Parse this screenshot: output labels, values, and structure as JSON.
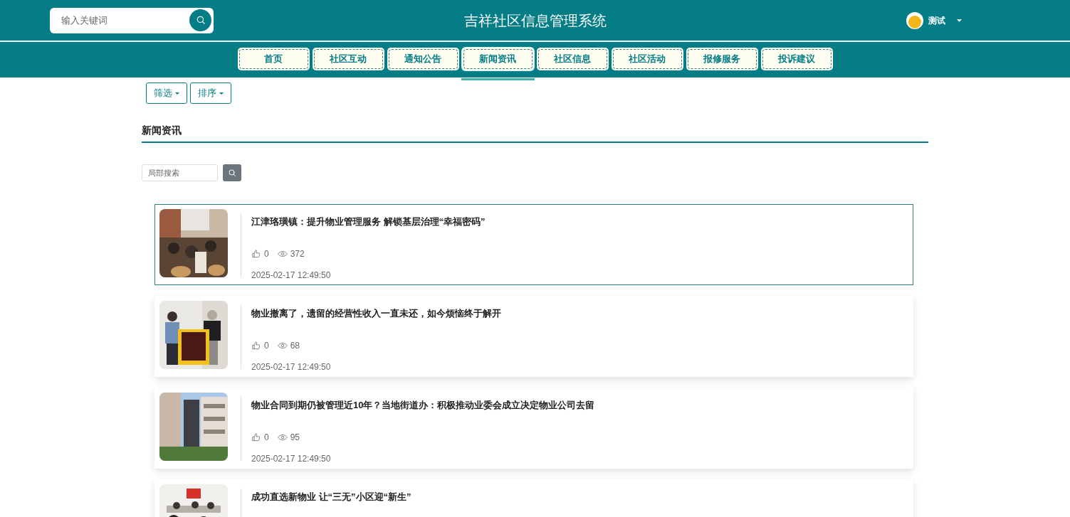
{
  "header": {
    "search": {
      "placeholder": "输入关键词"
    },
    "title": "吉祥社区信息管理系统",
    "user": {
      "name": "测试"
    }
  },
  "nav": [
    {
      "label": "首页",
      "selected": false
    },
    {
      "label": "社区互动",
      "selected": false
    },
    {
      "label": "通知公告",
      "selected": false
    },
    {
      "label": "新闻资讯",
      "selected": true
    },
    {
      "label": "社区信息",
      "selected": false
    },
    {
      "label": "社区活动",
      "selected": false
    },
    {
      "label": "报修服务",
      "selected": false
    },
    {
      "label": "投诉建议",
      "selected": false
    }
  ],
  "toolbar": [
    "筛选",
    "排序"
  ],
  "section_title": "新闻资讯",
  "local_search": {
    "placeholder": "局部搜索"
  },
  "news": [
    {
      "title": "江津珞璜镇：提升物业管理服务 解锁基层治理“幸福密码”",
      "likes": "0",
      "views": "372",
      "date": "2025-02-17 12:49:50",
      "selected": true
    },
    {
      "title": "物业撤离了，遗留的经营性收入一直未还，如今烦恼终于解开",
      "likes": "0",
      "views": "68",
      "date": "2025-02-17 12:49:50",
      "selected": false
    },
    {
      "title": "物业合同到期仍被管理近10年？当地街道办：积极推动业委会成立决定物业公司去留",
      "likes": "0",
      "views": "95",
      "date": "2025-02-17 12:49:50",
      "selected": false
    },
    {
      "title": "成功直选新物业 让“三无”小区迎“新生”",
      "selected": false
    }
  ]
}
